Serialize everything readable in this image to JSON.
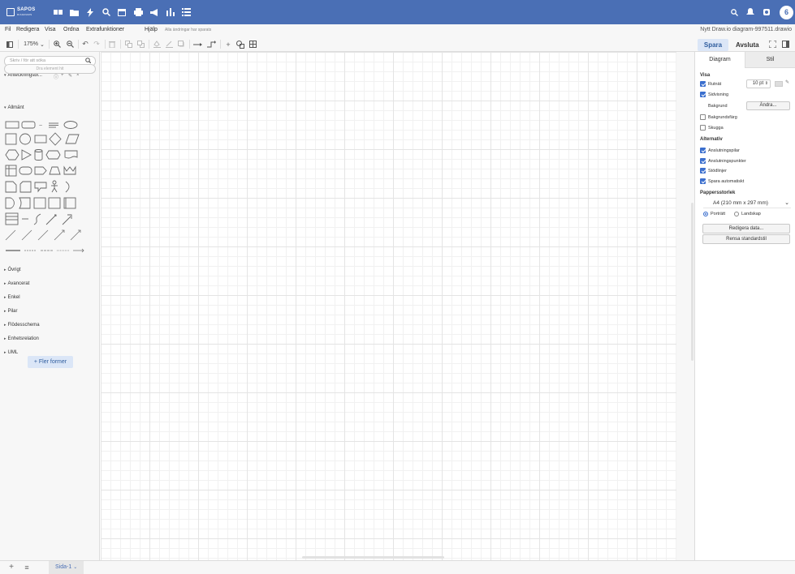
{
  "appbar": {
    "logo_text": "SAPOS",
    "logo_sub": "DIAGRAMS",
    "avatar_initial": "6",
    "color": "#4a6fb5"
  },
  "menu": {
    "items": [
      "Fil",
      "Redigera",
      "Visa",
      "Ordna",
      "Extrafunktioner",
      "Hjälp"
    ],
    "unsaved_note": "Alla ändringar har sparats",
    "document_title": "Nytt Draw.io diagram-997511.drawio"
  },
  "toolbar": {
    "zoom": "175%",
    "save_label": "Spara",
    "exit_label": "Avsluta"
  },
  "sidebar": {
    "search_placeholder": "Skriv / för att söka",
    "scratchpad_title": "Anteckningsbl...",
    "dropzone_text": "Dra element hit",
    "general_title": "Allmänt",
    "sections": [
      "Övrigt",
      "Avancerat",
      "Enkel",
      "Pilar",
      "Flödesschema",
      "Enhetsrelation",
      "UML"
    ],
    "more_shapes": "+ Fler former"
  },
  "format_panel": {
    "tabs": [
      "Diagram",
      "Stil"
    ],
    "view_title": "Visa",
    "grid_label": "Rutnät",
    "grid_size": "10 pt",
    "page_view_label": "Sidvisning",
    "background_label": "Bakgrund",
    "change_button": "Ändra...",
    "background_color_label": "Bakgrundsfärg",
    "shadow_label": "Skugga",
    "options_title": "Alternativ",
    "options": [
      "Anslutningspilar",
      "Anslutningspunkter",
      "Stödlinjer",
      "Spara automatiskt"
    ],
    "paper_title": "Pappersstorlek",
    "paper_size": "A4 (210 mm x 297 mm)",
    "portrait_label": "Porträtt",
    "landscape_label": "Landskap",
    "edit_data_button": "Redigera data...",
    "clear_default_button": "Rensa standardstil",
    "checked": {
      "grid": true,
      "page_view": true,
      "background_color": false,
      "shadow": false,
      "options": [
        true,
        true,
        true,
        true
      ]
    }
  },
  "bottom": {
    "page_tab": "Sida-1"
  }
}
